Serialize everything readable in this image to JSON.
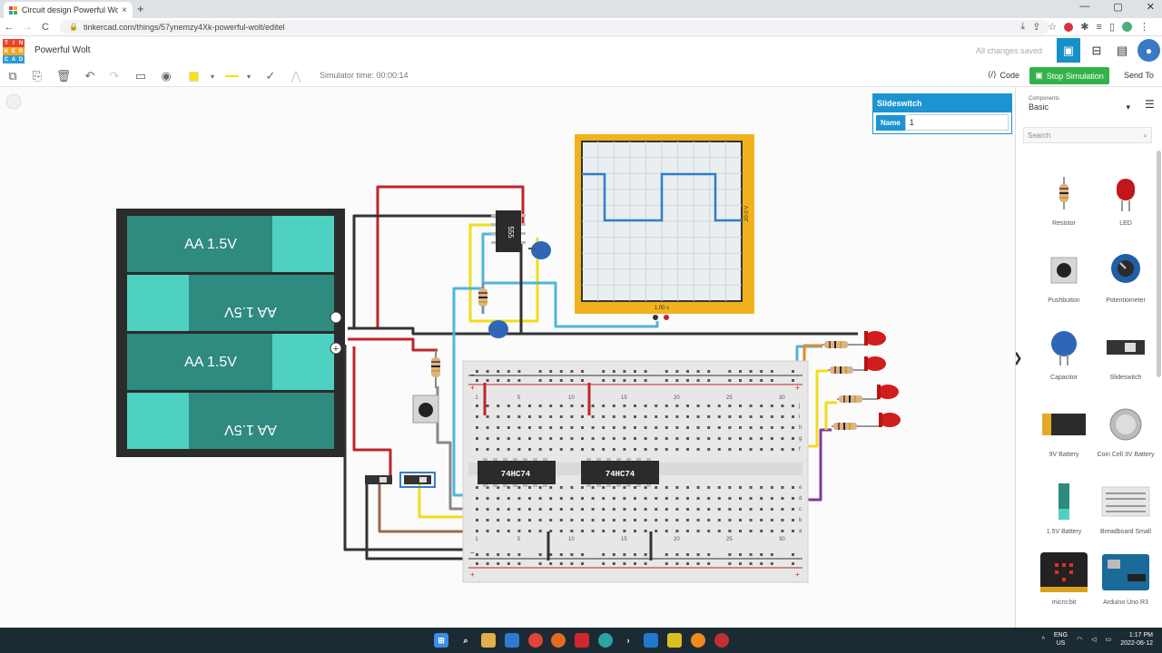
{
  "browser": {
    "tab_title": "Circuit design Powerful Wolt | Tin",
    "tab_close": "×",
    "new_tab": "+",
    "url": "tinkercad.com/things/57ynemzy4Xk-powerful-wolt/editel",
    "back": "←",
    "forward": "→",
    "reload": "C",
    "minimize": "—",
    "maximize": "▢",
    "close": "✕"
  },
  "header": {
    "logo_letters": [
      "T",
      "I",
      "N",
      "K",
      "E",
      "R",
      "C",
      "A",
      "D"
    ],
    "logo_colors": [
      "#e8432d",
      "#e8432d",
      "#e8432d",
      "#f5a623",
      "#f5a623",
      "#f5a623",
      "#2e9bd6",
      "#2e9bd6",
      "#2e9bd6"
    ],
    "project_name": "Powerful Wolt",
    "save_status": "All changes saved"
  },
  "toolbar": {
    "simulator_time": "Simulator time: 00:00:14",
    "code_label": "Code",
    "stop_label": "Stop Simulation",
    "send_to_label": "Send To"
  },
  "inspector": {
    "title": "Slideswitch",
    "name_label": "Name",
    "name_value": "1"
  },
  "panel": {
    "components_label": "Components",
    "category": "Basic",
    "search_placeholder": "Search",
    "items": [
      {
        "name": "Resistor",
        "icon": "resistor-icon"
      },
      {
        "name": "LED",
        "icon": "led-icon"
      },
      {
        "name": "Pushbutton",
        "icon": "pushbutton-icon"
      },
      {
        "name": "Potentiometer",
        "icon": "potentiometer-icon"
      },
      {
        "name": "Capacitor",
        "icon": "capacitor-icon"
      },
      {
        "name": "Slideswitch",
        "icon": "slideswitch-icon"
      },
      {
        "name": "9V Battery",
        "icon": "battery-9v-icon"
      },
      {
        "name": "Coin Cell 3V Battery",
        "icon": "coin-cell-icon"
      },
      {
        "name": "1.5V Battery",
        "icon": "battery-aa-icon"
      },
      {
        "name": "Breadboard Small",
        "icon": "breadboard-icon"
      },
      {
        "name": "micro:bit",
        "icon": "microbit-icon"
      },
      {
        "name": "Arduino Uno R3",
        "icon": "arduino-icon"
      }
    ]
  },
  "circuit": {
    "battery_label_1": "AA 1.5V",
    "battery_label_2": "AA 1.5V",
    "battery_label_3": "AA 1.5V",
    "battery_label_4": "AA 1.5V",
    "timer_chip": "555",
    "flipflop_1": "74HC74",
    "flipflop_2": "74HC74",
    "scope_voltage": "20.0 V",
    "scope_time": "1.00 s",
    "bb_row_numbers": [
      "1",
      "5",
      "10",
      "15",
      "20",
      "25",
      "30"
    ],
    "bb_row_letters_top": [
      "j",
      "i",
      "h",
      "g",
      "f"
    ],
    "bb_row_letters_bottom": [
      "e",
      "d",
      "c",
      "b",
      "a"
    ],
    "plus": "+",
    "minus": "−"
  },
  "taskbar": {
    "lang_line1": "ENG",
    "lang_line2": "US",
    "time": "1:17 PM",
    "date": "2022-06-12"
  },
  "colors": {
    "accent": "#1690c8",
    "stop_green": "#33b249",
    "battery_body": "#2f8a80",
    "battery_cap": "#4fd1c1",
    "scope_frame": "#f2b21e",
    "wire_red": "#c0242b",
    "wire_black": "#333333",
    "wire_yellow": "#f2dc1b",
    "wire_blue": "#4fb6d8",
    "wire_orange": "#e08a2a",
    "wire_purple": "#7b3aa0"
  }
}
